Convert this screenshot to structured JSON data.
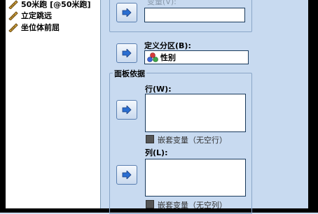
{
  "variables": [
    {
      "label": "50米跑 [@50米跑]",
      "icon": "ruler-icon"
    },
    {
      "label": "立定跳远",
      "icon": "ruler-icon"
    },
    {
      "label": "坐位体前屈",
      "icon": "ruler-icon"
    }
  ],
  "variable_field": {
    "label": "变量(V):"
  },
  "define_partition": {
    "label": "定义分区(B):",
    "value": "性别",
    "icon": "nominal-variable-icon"
  },
  "panel_group": {
    "title": "面板依据",
    "rows": {
      "label": "行(W):",
      "nest_label": "嵌套变量（无空行）"
    },
    "columns": {
      "label": "列(L):",
      "nest_label": "嵌套变量（无空列）"
    }
  },
  "colors": {
    "accent": "#2b6ed1",
    "pane": "#c8daf0"
  }
}
